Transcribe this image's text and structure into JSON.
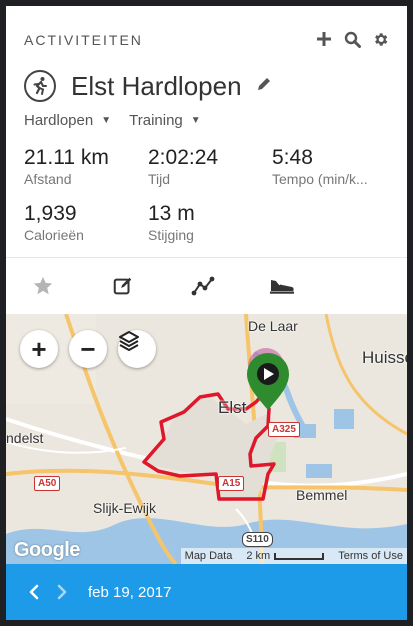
{
  "header": {
    "title": "ACTIVITEITEN"
  },
  "activity": {
    "title": "Elst Hardlopen",
    "type": "Hardlopen",
    "event": "Training"
  },
  "stats": [
    {
      "value": "21.11 km",
      "label": "Afstand"
    },
    {
      "value": "2:02:24",
      "label": "Tijd"
    },
    {
      "value": "5:48",
      "label": "Tempo (min/k..."
    },
    {
      "value": "1,939",
      "label": "Calorieën"
    },
    {
      "value": "13 m",
      "label": "Stijging"
    }
  ],
  "map": {
    "places": [
      "De Laar",
      "Huisse",
      "Elst",
      "ndelst",
      "Slijk-Ewijk",
      "Bemmel"
    ],
    "roads": [
      "A325",
      "A15",
      "A50",
      "S110"
    ],
    "attribution": {
      "data": "Map Data",
      "scale": "2 km",
      "terms": "Terms of Use"
    },
    "logo": "Google"
  },
  "footer": {
    "date": "feb 19, 2017"
  },
  "colors": {
    "accent": "#1e9be8",
    "route": "#e0162b",
    "marker": "#2e8b2e"
  }
}
